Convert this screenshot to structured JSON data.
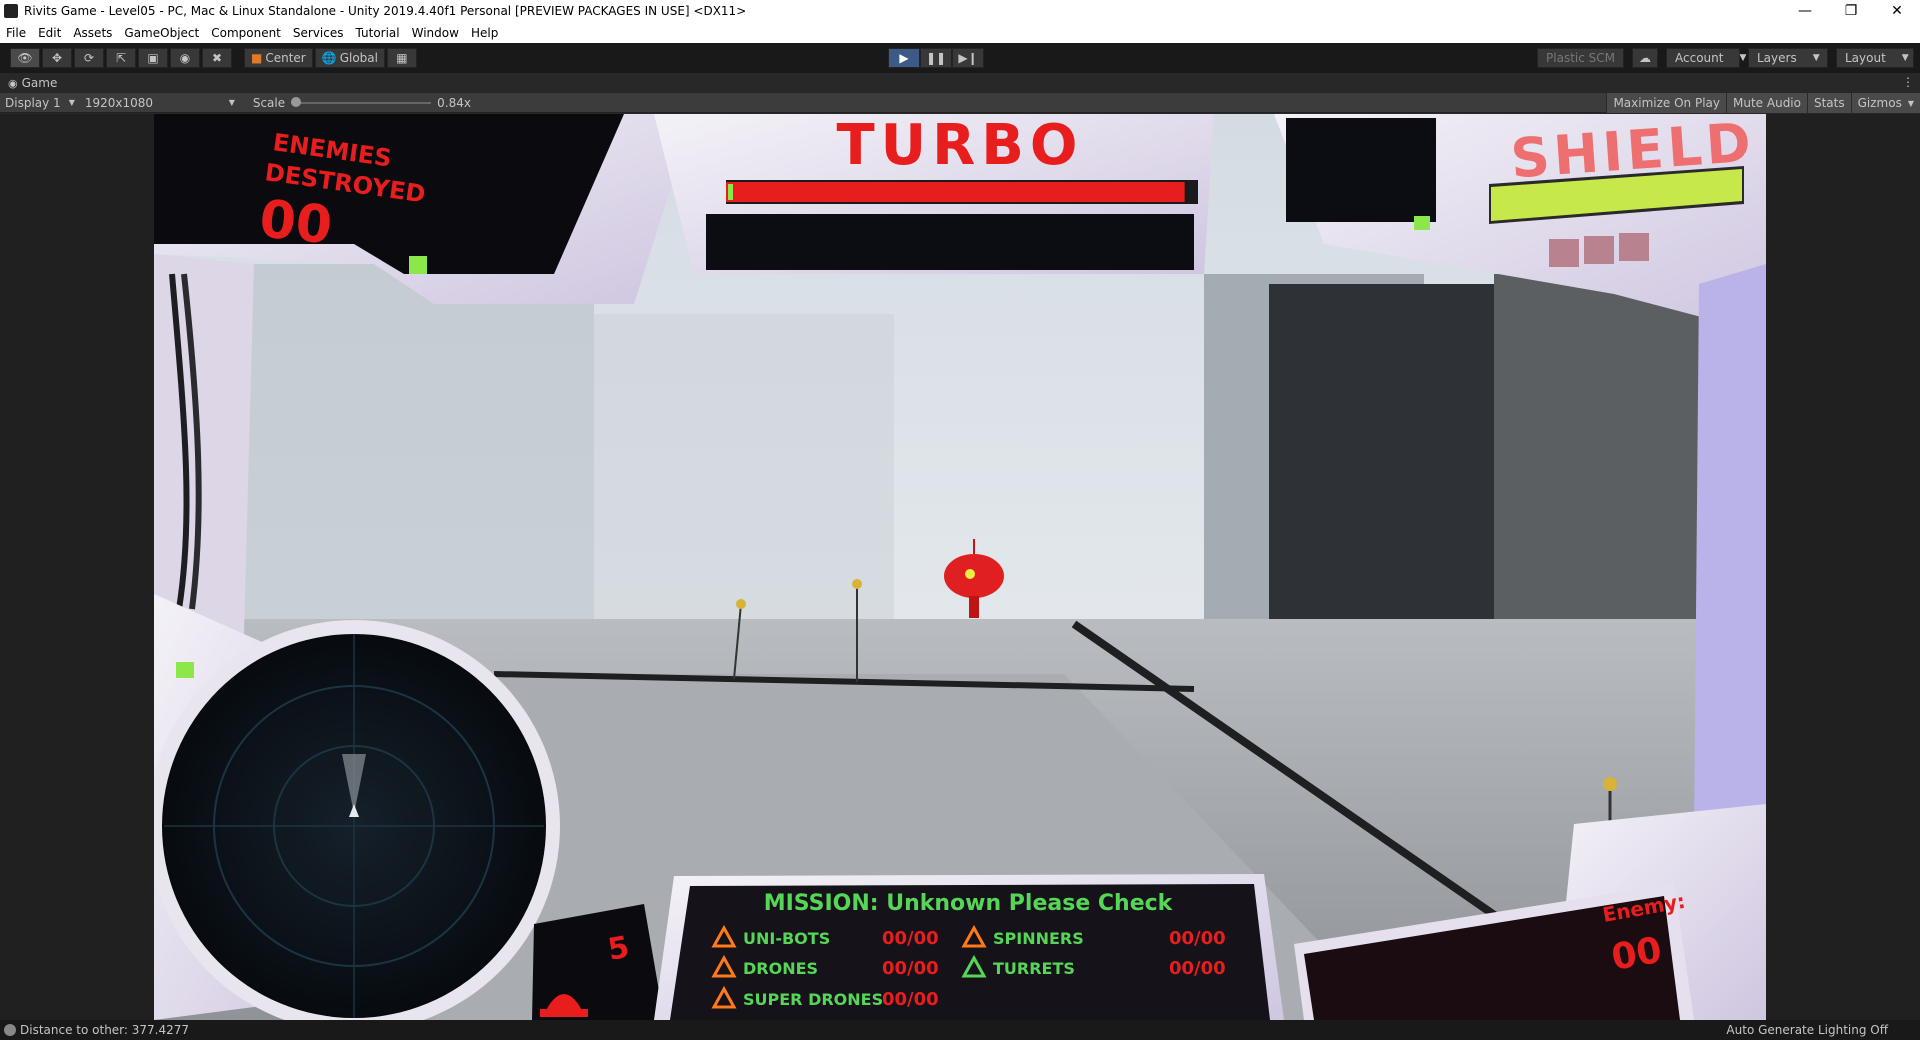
{
  "window": {
    "title": "Rivits Game - Level05 - PC, Mac & Linux Standalone - Unity 2019.4.40f1 Personal [PREVIEW PACKAGES IN USE] <DX11>",
    "controls": [
      "minimize",
      "restore",
      "close"
    ]
  },
  "menu": [
    "File",
    "Edit",
    "Assets",
    "GameObject",
    "Component",
    "Services",
    "Tutorial",
    "Window",
    "Help"
  ],
  "toolbar": {
    "pivot_label": "Center",
    "space_label": "Global",
    "plastic_label": "Plastic SCM",
    "account_label": "Account",
    "layers_label": "Layers",
    "layout_label": "Layout"
  },
  "tab": {
    "label": "Game"
  },
  "gamebar": {
    "display": "Display 1",
    "resolution": "1920x1080",
    "scale_label": "Scale",
    "scale_value": "0.84x",
    "scale_fraction": 0.0,
    "maximize": "Maximize On Play",
    "mute": "Mute Audio",
    "stats": "Stats",
    "gizmos": "Gizmos"
  },
  "hud": {
    "enemies_title_1": "ENEMIES",
    "enemies_title_2": "DESTROYED",
    "enemies_count": "00",
    "turbo_label": "TURBO",
    "turbo_level": 0.98,
    "shield_label": "SHIELD",
    "shield_level": 1.0,
    "mission_title": "MISSION: Unknown Please Check",
    "objectives": [
      {
        "name": "UNI-BOTS",
        "count": "00/00",
        "color": "#ff7a1a"
      },
      {
        "name": "DRONES",
        "count": "00/00",
        "color": "#ff7a1a"
      },
      {
        "name": "SUPER DRONES",
        "count": "00/00",
        "color": "#ff7a1a"
      },
      {
        "name": "SPINNERS",
        "count": "00/00",
        "color": "#ff7a1a"
      },
      {
        "name": "TURRETS",
        "count": "00/00",
        "color": "#56d657"
      }
    ],
    "lives": "5",
    "enemy_label": "Enemy:",
    "enemy_count": "00"
  },
  "status": {
    "left": "Distance to other: 377.4277",
    "right": "Auto Generate Lighting Off"
  },
  "colors": {
    "hud_red": "#e81d1d",
    "hud_green": "#56d657",
    "shield_bar": "#c6e84a",
    "play_blue": "#3b5a86"
  }
}
